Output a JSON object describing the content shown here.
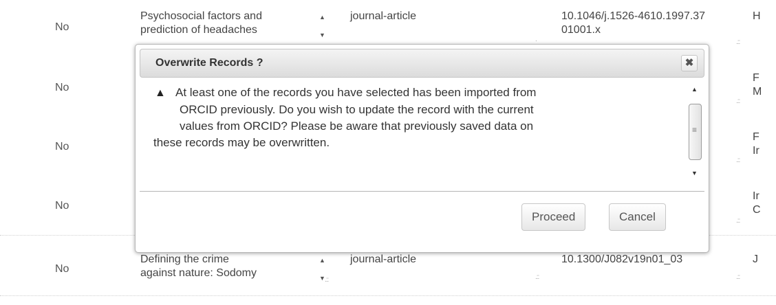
{
  "table": {
    "rows": [
      {
        "no": "No",
        "title_lines": [
          "Psychosocial factors and",
          "prediction of headaches"
        ],
        "type": "journal-article",
        "doi_lines": [
          "10.1046/j.1526-4610.1997.37",
          "01001.x"
        ],
        "extra_lines": [
          "H",
          ""
        ]
      },
      {
        "no": "No",
        "title_lines": [
          "",
          ""
        ],
        "type": "",
        "doi_lines": [
          "",
          ""
        ],
        "extra_lines": [
          "F",
          "M"
        ]
      },
      {
        "no": "No",
        "title_lines": [
          "",
          ""
        ],
        "type": "",
        "doi_lines": [
          "",
          ""
        ],
        "extra_lines": [
          "F",
          "Ir"
        ]
      },
      {
        "no": "No",
        "title_lines": [
          "",
          ""
        ],
        "type": "",
        "doi_lines": [
          "",
          ""
        ],
        "extra_lines": [
          "Ir",
          "C"
        ]
      },
      {
        "no": "No",
        "title_lines": [
          "Defining the crime",
          "against nature: Sodomy"
        ],
        "type": "journal-article",
        "doi_lines": [
          "10.1300/J082v19n01_03",
          ""
        ],
        "extra_lines": [
          "J",
          ""
        ]
      }
    ]
  },
  "dialog": {
    "title": "Overwrite Records ?",
    "close_glyph": "✖",
    "warning_icon": "warning-icon",
    "message_lines": [
      "At least one of the records you have selected has been imported from",
      "ORCID previously. Do you wish to update the record with the current",
      "values from ORCID? Please be aware that previously saved data on",
      "these records may be overwritten."
    ],
    "proceed_label": "Proceed",
    "cancel_label": "Cancel"
  }
}
